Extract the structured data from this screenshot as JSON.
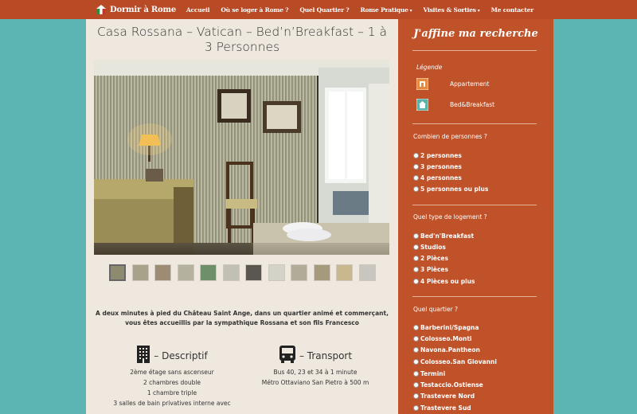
{
  "header": {
    "brand": "Dormir à Rome",
    "nav": [
      {
        "label": "Accueil",
        "dropdown": false
      },
      {
        "label": "Où se loger à Rome ?",
        "dropdown": false
      },
      {
        "label": "Quel Quartier ?",
        "dropdown": false
      },
      {
        "label": "Rome Pratique",
        "dropdown": true
      },
      {
        "label": "Visites & Sorties",
        "dropdown": true
      },
      {
        "label": "Me contacter",
        "dropdown": false
      }
    ]
  },
  "main": {
    "title": "Casa Rossana – Vatican – Bed’n’Breakfast – 1 à 3 Personnes",
    "intro": "A deux minutes à pied du Château Saint Ange, dans un quartier animé et commerçant, vous êtes accueillis par la sympathique Rossana et son fils Francesco",
    "description": {
      "title": "– Descriptif",
      "icon": "building-icon",
      "lines": [
        "2ème étage sans ascenseur",
        "2 chambres double",
        "1 chambre triple",
        "3 salles de bain privatives interne avec"
      ]
    },
    "transport": {
      "title": "– Transport",
      "icon": "bus-icon",
      "lines": [
        "Bus 40, 23 et 34 à 1 minute",
        "Métro Ottaviano San Pietro à 500 m"
      ]
    }
  },
  "sidebar": {
    "title": "J'affine ma recherche",
    "legend": {
      "label": "Légende",
      "items": [
        {
          "label": "Appartement",
          "icon": "apartment-icon"
        },
        {
          "label": "Bed&Breakfast",
          "icon": "bnb-icon"
        }
      ]
    },
    "persons": {
      "question": "Combien de personnes ?",
      "options": [
        "2 personnes",
        "3 personnes",
        "4 personnes",
        "5 personnes ou plus"
      ]
    },
    "lodging": {
      "question": "Quel type de logement ?",
      "options": [
        "Bed'n'Breakfast",
        "Studios",
        "2 Pièces",
        "3 Pièces",
        "4 Pièces ou plus"
      ]
    },
    "district": {
      "question": "Quel quartier ?",
      "options": [
        "Barberini/Spagna",
        "Colosseo.Monti",
        "Navona.Pantheon",
        "Colosseo.San Giovanni",
        "Termini",
        "Testaccio.Ostiense",
        "Trastevere Nord",
        "Trastevere Sud"
      ]
    }
  },
  "colors": {
    "header": "#b84a26",
    "sidebar": "#c0522a",
    "background": "#5db5b3",
    "panel": "#efe8df"
  }
}
